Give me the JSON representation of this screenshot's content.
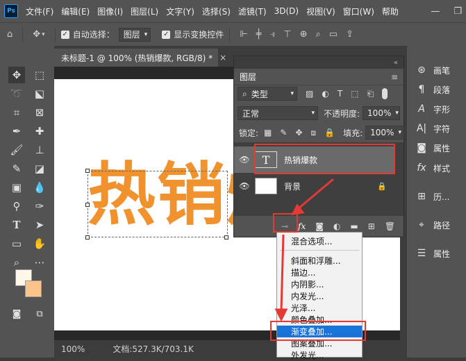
{
  "app": {
    "logo": "Ps"
  },
  "menubar": {
    "items": [
      "文件(F)",
      "编辑(E)",
      "图像(I)",
      "图层(L)",
      "文字(Y)",
      "选择(S)",
      "滤镜(T)",
      "3D(D)",
      "视图(V)",
      "窗口(W)",
      "帮助"
    ],
    "minimize": "—",
    "restore": "❐"
  },
  "options": {
    "auto_select_label": "自动选择：",
    "auto_select_value": "图层",
    "transform_label": "显示变换控件"
  },
  "document": {
    "tab_title": "未标题-1 @ 100% (热销爆款, RGB/8) *",
    "tab_close": "×",
    "canvas_text": "热销爆",
    "zoom": "100%",
    "doc_size": "文档:527.3K/703.1K"
  },
  "layers_panel": {
    "title": "图层",
    "filter_type": "类型",
    "blend_mode": "正常",
    "opacity_label": "不透明度:",
    "opacity_value": "100%",
    "lock_label": "锁定:",
    "fill_label": "填充:",
    "fill_value": "100%",
    "layers": [
      {
        "name": "热销爆款",
        "thumb": "T"
      },
      {
        "name": "背景",
        "thumb": ""
      }
    ],
    "fx_button": "fx"
  },
  "right_dock": {
    "items": [
      "画笔",
      "段落",
      "字形",
      "字符",
      "属性",
      "样式",
      "历...",
      "路径",
      "属性"
    ]
  },
  "fx_menu": {
    "items": [
      "混合选项...",
      "斜面和浮雕...",
      "描边...",
      "内阴影...",
      "内发光...",
      "光泽...",
      "颜色叠加...",
      "渐变叠加...",
      "图案叠加...",
      "外发光..."
    ],
    "highlighted": "渐变叠加..."
  },
  "colors": {
    "accent_orange": "#f0922e",
    "highlight_blue": "#1a73d9",
    "annotation_red": "#e53935"
  }
}
